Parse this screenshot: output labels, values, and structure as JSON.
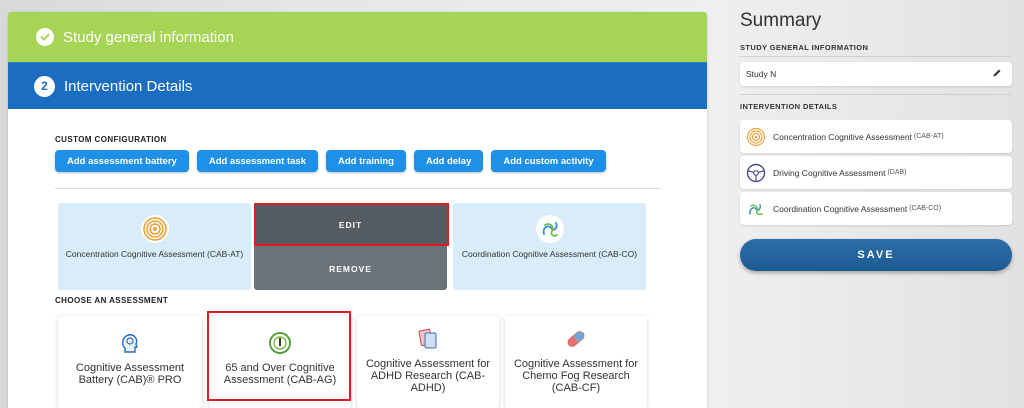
{
  "steps": {
    "step1": {
      "label": "Study general information"
    },
    "step2": {
      "number": "2",
      "label": "Intervention Details"
    }
  },
  "custom_config": {
    "title": "CUSTOM CONFIGURATION",
    "buttons": [
      "Add assessment battery",
      "Add assessment task",
      "Add training",
      "Add delay",
      "Add custom activity"
    ]
  },
  "selected": [
    {
      "label": "Concentration Cognitive Assessment (CAB-AT)",
      "icon": "concentration-icon"
    },
    {
      "label": "Coordination Cognitive Assessment (CAB-CO)",
      "icon": "coordination-icon"
    }
  ],
  "overlay": {
    "edit": "EDIT",
    "remove": "REMOVE"
  },
  "choose": {
    "title": "CHOOSE AN ASSESSMENT",
    "cards": [
      {
        "label": "Cognitive Assessment Battery (CAB)® PRO",
        "icon": "head-icon"
      },
      {
        "label": "65 and Over Cognitive Assessment (CAB-AG)",
        "icon": "senior-icon"
      },
      {
        "label": "Cognitive Assessment for ADHD Research (CAB-ADHD)",
        "icon": "cards-icon"
      },
      {
        "label": "Cognitive Assessment for Chemo Fog Research (CAB-CF)",
        "icon": "pill-icon"
      }
    ]
  },
  "summary": {
    "title": "Summary",
    "general_label": "STUDY GENERAL INFORMATION",
    "study_name": "Study N",
    "intervention_label": "INTERVENTION DETAILS",
    "items": [
      {
        "name": "Concentration Cognitive Assessment",
        "code": "(CAB-AT)"
      },
      {
        "name": "Driving Cognitive Assessment",
        "code": "(DAB)"
      },
      {
        "name": "Coordination Cognitive Assessment",
        "code": "(CAB-CO)"
      }
    ],
    "save": "SAVE"
  },
  "colors": {
    "green": "#a6d455",
    "blue": "#1a6dbf",
    "button": "#1e90e8",
    "highlight": "#e01b24"
  }
}
